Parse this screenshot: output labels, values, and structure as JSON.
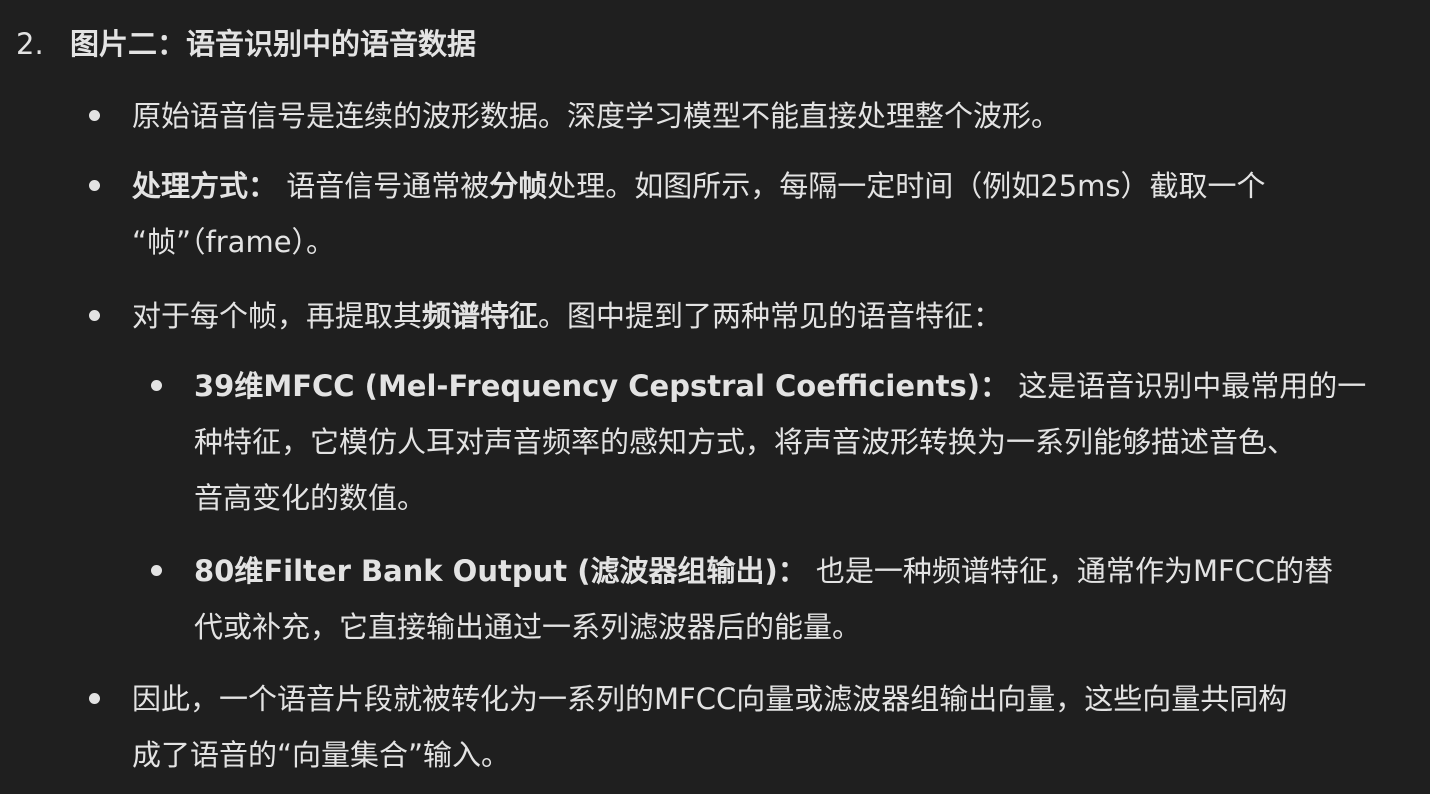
{
  "heading": {
    "number": "2.",
    "title": "图片二：语音识别中的语音数据"
  },
  "bullets": {
    "b1": {
      "line1": "原始语音信号是连续的波形数据。深度学习模型不能直接处理整个波形。"
    },
    "b2": {
      "label": "处理方式：",
      "line1_pre": " 语音信号通常被",
      "line1_bold": "分帧",
      "line1_post": "处理。如图所示，每隔一定时间（例如25ms）截取一个",
      "line2": "“帧”（frame）。"
    },
    "b3": {
      "pre": "对于每个帧，再提取其",
      "bold": "频谱特征",
      "post": "。图中提到了两种常见的语音特征："
    },
    "b3a": {
      "label": "39维MFCC (Mel-Frequency Cepstral Coefficients)：",
      "line1_post": " 这是语音识别中最常用的一",
      "line2": "种特征，它模仿人耳对声音频率的感知方式，将声音波形转换为一系列能够描述音色、",
      "line3": "音高变化的数值。"
    },
    "b3b": {
      "label": "80维Filter Bank Output (滤波器组输出)：",
      "line1_post": " 也是一种频谱特征，通常作为MFCC的替",
      "line2": "代或补充，它直接输出通过一系列滤波器后的能量。"
    },
    "b4": {
      "line1": "因此，一个语音片段就被转化为一系列的MFCC向量或滤波器组输出向量，这些向量共同构",
      "line2": "成了语音的“向量集合”输入。"
    }
  }
}
